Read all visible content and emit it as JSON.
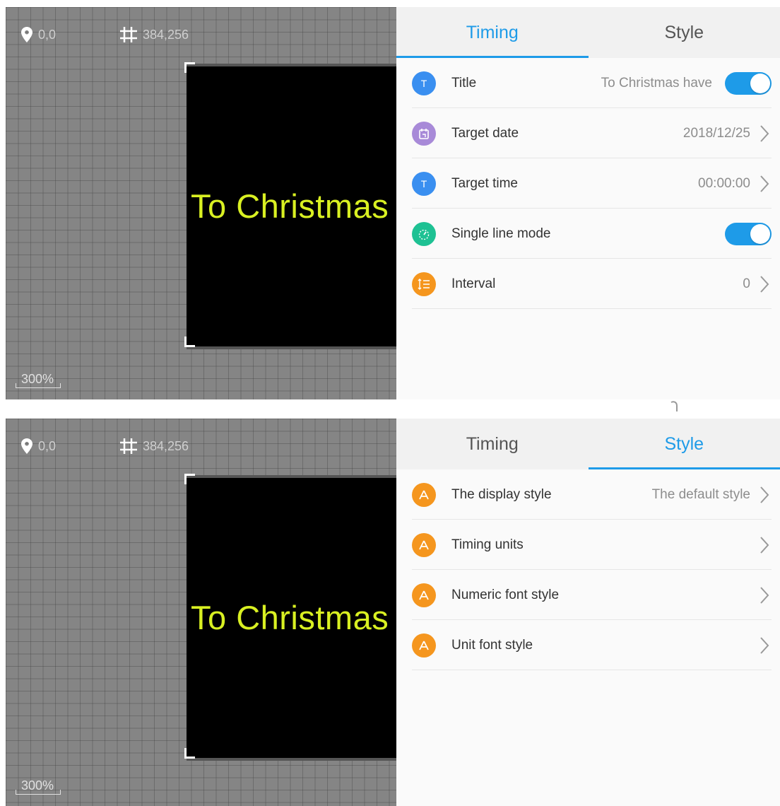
{
  "screens": [
    {
      "canvas": {
        "position": "0,0",
        "size": "384,256",
        "led_text": "To Christmas",
        "zoom": "300%"
      },
      "tabs": [
        {
          "label": "Timing",
          "active": true
        },
        {
          "label": "Style",
          "active": false
        }
      ],
      "rows": [
        {
          "label": "Title",
          "value": "To Christmas have",
          "control": "toggle",
          "icon": "text-icon"
        },
        {
          "label": "Target date",
          "value": "2018/12/25",
          "control": "chevron",
          "icon": "calendar-icon"
        },
        {
          "label": "Target time",
          "value": "00:00:00",
          "control": "chevron",
          "icon": "text-icon"
        },
        {
          "label": "Single line mode",
          "value": "",
          "control": "toggle",
          "icon": "speedometer-icon"
        },
        {
          "label": "Interval",
          "value": "0",
          "control": "chevron",
          "icon": "line-spacing-icon"
        }
      ]
    },
    {
      "canvas": {
        "position": "0,0",
        "size": "384,256",
        "led_text": "To Christmas",
        "zoom": "300%"
      },
      "tabs": [
        {
          "label": "Timing",
          "active": false
        },
        {
          "label": "Style",
          "active": true
        }
      ],
      "rows": [
        {
          "label": "The display style",
          "value": "The default style",
          "control": "chevron",
          "icon": "style-icon"
        },
        {
          "label": "Timing units",
          "value": "",
          "control": "chevron",
          "icon": "style-icon"
        },
        {
          "label": "Numeric font style",
          "value": "",
          "control": "chevron",
          "icon": "style-icon"
        },
        {
          "label": "Unit font style",
          "value": "",
          "control": "chevron",
          "icon": "style-icon"
        }
      ]
    }
  ],
  "icon_glyphs": {
    "text_letter": "T"
  },
  "colors": {
    "accent": "#1e9be8",
    "led_text": "#d9f022",
    "led_bg": "#000000",
    "canvas_bg": "#858585",
    "icon_orange": "#f5961e",
    "icon_blue": "#3a8ff0",
    "icon_purple": "#a88ad8",
    "icon_green": "#1ec193"
  }
}
